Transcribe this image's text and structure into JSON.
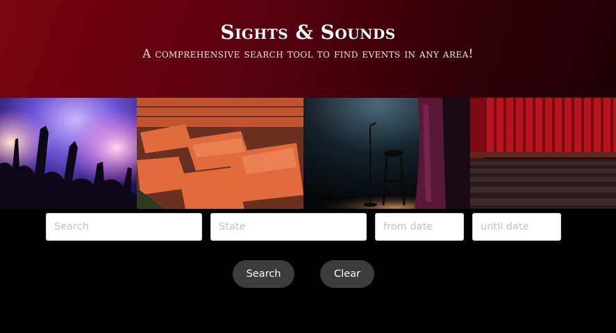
{
  "header": {
    "title": "Sights & Sounds",
    "subtitle": "A comprehensive search tool to find events in any area!"
  },
  "gallery": {
    "images": [
      {
        "name": "concert-crowd-photo"
      },
      {
        "name": "stadium-seats-photo"
      },
      {
        "name": "comedy-stage-photo"
      },
      {
        "name": "theater-curtain-photo"
      }
    ]
  },
  "form": {
    "search_placeholder": "Search",
    "state_placeholder": "State",
    "from_date_placeholder": "from date",
    "until_date_placeholder": "until date",
    "search_button_label": "Search",
    "clear_button_label": "Clear"
  },
  "colors": {
    "header_gradient_start": "#7a0410",
    "header_gradient_end": "#1d0007",
    "page_background": "#000000",
    "button_background": "#3c3c3c"
  }
}
